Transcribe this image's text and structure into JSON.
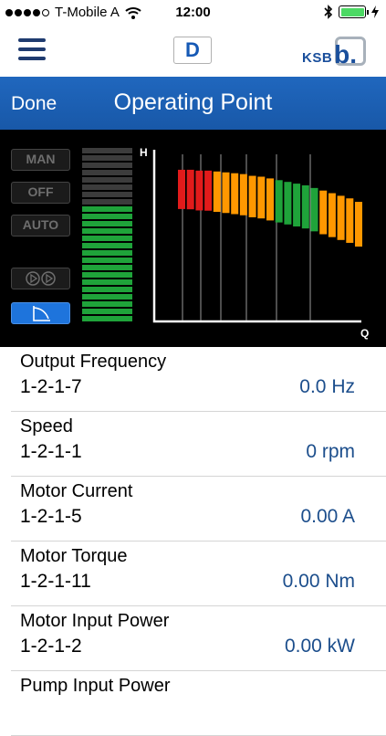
{
  "status_bar": {
    "carrier": "T-Mobile A",
    "time": "12:00",
    "signal_dots": 4,
    "signal_total": 5,
    "battery_level": 1.0
  },
  "nav": {
    "menu_icon": "hamburger-icon",
    "mode_badge": "D",
    "brand": "KSB",
    "brand_mark": "b."
  },
  "header": {
    "done_label": "Done",
    "title": "Operating Point"
  },
  "controls": {
    "man_label": "MAN",
    "off_label": "OFF",
    "auto_label": "AUTO"
  },
  "level_meter": {
    "total_segments": 24,
    "lit_segments": 16,
    "lit_color": "#1fa33a",
    "off_color": "#3c3c3c"
  },
  "chart_data": {
    "type": "bar",
    "xlabel": "Q",
    "ylabel": "H",
    "bars": [
      {
        "value": 0.98,
        "color": "#e11b1b"
      },
      {
        "value": 0.98,
        "color": "#e11b1b"
      },
      {
        "value": 0.97,
        "color": "#e11b1b"
      },
      {
        "value": 0.97,
        "color": "#e11b1b"
      },
      {
        "value": 0.96,
        "color": "#ff9800"
      },
      {
        "value": 0.95,
        "color": "#ff9800"
      },
      {
        "value": 0.94,
        "color": "#ff9800"
      },
      {
        "value": 0.93,
        "color": "#ff9800"
      },
      {
        "value": 0.91,
        "color": "#ff9800"
      },
      {
        "value": 0.9,
        "color": "#ff9800"
      },
      {
        "value": 0.88,
        "color": "#ff9800"
      },
      {
        "value": 0.86,
        "color": "#1fa33a"
      },
      {
        "value": 0.84,
        "color": "#1fa33a"
      },
      {
        "value": 0.82,
        "color": "#1fa33a"
      },
      {
        "value": 0.8,
        "color": "#1fa33a"
      },
      {
        "value": 0.77,
        "color": "#1fa33a"
      },
      {
        "value": 0.74,
        "color": "#ff9800"
      },
      {
        "value": 0.71,
        "color": "#ff9800"
      },
      {
        "value": 0.68,
        "color": "#ff9800"
      },
      {
        "value": 0.65,
        "color": "#ff9800"
      },
      {
        "value": 0.61,
        "color": "#ff9800"
      }
    ]
  },
  "parameters": [
    {
      "name": "Output Frequency",
      "code": "1-2-1-7",
      "value": "0.0 Hz"
    },
    {
      "name": "Speed",
      "code": "1-2-1-1",
      "value": "0 rpm"
    },
    {
      "name": "Motor Current",
      "code": "1-2-1-5",
      "value": "0.00 A"
    },
    {
      "name": "Motor Torque",
      "code": "1-2-1-11",
      "value": "0.00 Nm"
    },
    {
      "name": "Motor Input Power",
      "code": "1-2-1-2",
      "value": "0.00 kW"
    },
    {
      "name": "Pump Input Power",
      "code": "",
      "value": ""
    }
  ]
}
